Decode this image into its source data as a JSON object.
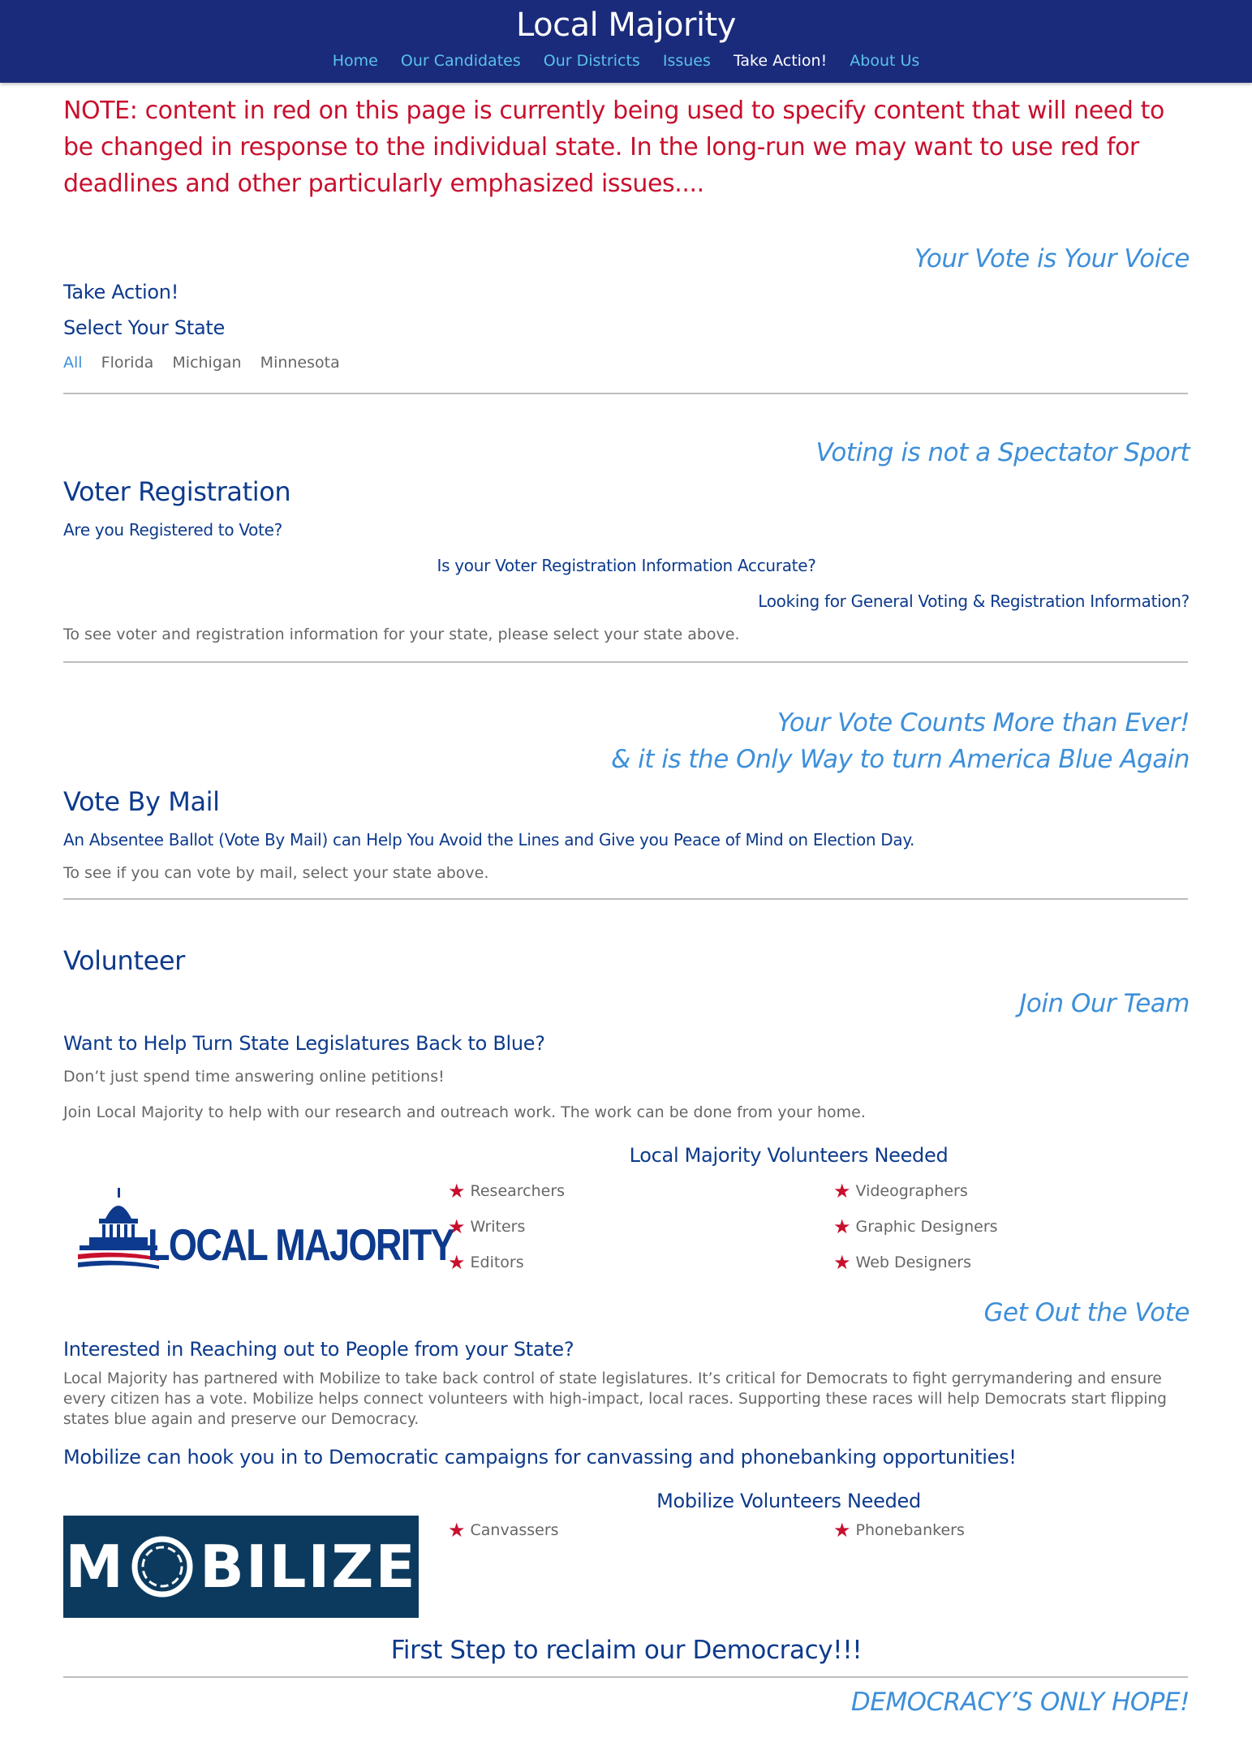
{
  "header": {
    "title": "Local Majority",
    "nav": [
      "Home",
      "Our Candidates",
      "Our Districts",
      "Issues",
      "Take Action!",
      "About Us"
    ],
    "active_nav": "Take Action!"
  },
  "note": "NOTE: content in red on this page is currently being used to specify content that will need to be changed in response to the individual state. In the long-run we may want to use red for deadlines and other particularly emphasized issues....",
  "take_action": {
    "tagline": "Your Vote is Your Voice",
    "heading": "Take Action!",
    "select_state": "Select Your State",
    "states": [
      "All",
      "Florida",
      "Michigan",
      "Minnesota"
    ]
  },
  "registration": {
    "tagline": "Voting is not a Spectator Sport",
    "heading": "Voter Registration",
    "q1": "Are you Registered to Vote?",
    "q2": "Is your Voter Registration Information Accurate?",
    "q3": "Looking for General Voting & Registration Information?",
    "body": "To see voter and registration information for your state, please select your state above."
  },
  "mail": {
    "tagline1": "Your Vote Counts More than Ever!",
    "tagline2": "& it is the Only Way to turn America Blue Again",
    "heading": "Vote By Mail",
    "sub": "An Absentee Ballot (Vote By Mail) can Help You Avoid the Lines and Give you Peace of Mind on Election Day.",
    "body": "To see if you can vote by mail, select your state above."
  },
  "volunteer": {
    "heading": "Volunteer",
    "tagline": "Join Our Team",
    "sub": "Want to Help Turn State Legislatures Back to Blue?",
    "p1": "Don’t just spend time answering online petitions!",
    "p2": "Join Local Majority to help with our research and outreach work. The work can be done from your home.",
    "needed_title": "Local Majority Volunteers Needed",
    "needed": [
      "Researchers",
      "Videographers",
      "Writers",
      "Graphic Designers",
      "Editors",
      "Web Designers"
    ],
    "logo_text": "LOCAL MAJORITY"
  },
  "gotv": {
    "tagline": "Get Out the Vote",
    "sub": "Interested in Reaching out to People from your State?",
    "body": "Local Majority has partnered with Mobilize to take back control of state legislatures. It’s critical for Democrats to fight gerrymandering and ensure every citizen has a vote. Mobilize helps connect volunteers with high-impact, local races. Supporting these races will help Democrats start flipping states blue again and preserve our Democracy.",
    "mobilize_line": "Mobilize can hook you in to Democratic campaigns for canvassing and phonebanking opportunities!",
    "needed_title": "Mobilize Volunteers Needed",
    "needed": [
      "Canvassers",
      "Phonebankers"
    ],
    "logo_left": "M",
    "logo_right": "BILIZE"
  },
  "footer": {
    "first_step": "First Step to reclaim our Democracy!!!",
    "tagline": "DEMOCRACY’S ONLY HOPE!"
  },
  "colors": {
    "navbar": "#1a2b7c",
    "nav_link": "#5bc2e7",
    "heading": "#0d3a8c",
    "tagline": "#3d8fd9",
    "note_red": "#c8102e"
  }
}
